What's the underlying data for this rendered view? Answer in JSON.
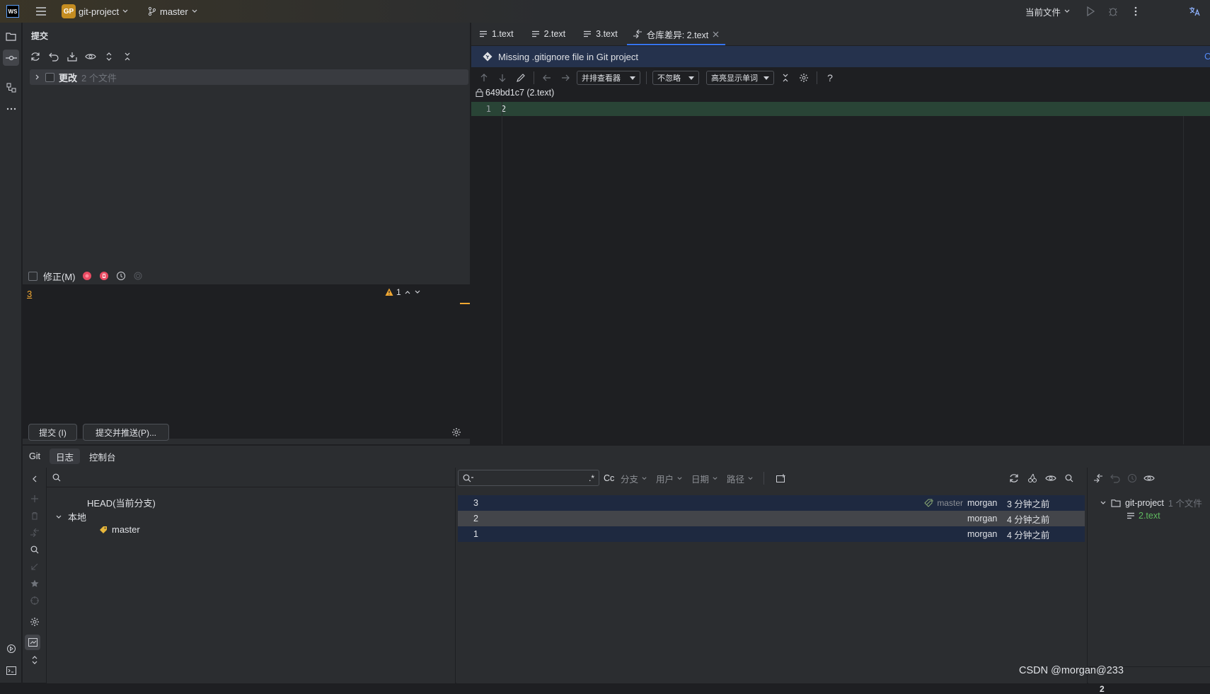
{
  "titlebar": {
    "app_logo": "WS",
    "project_badge": "GP",
    "project": "git-project",
    "branch": "master",
    "run_config": "当前文件"
  },
  "commit_panel": {
    "title": "提交",
    "changes_label": "更改",
    "changes_count": "2 个文件",
    "amend_label": "修正(M)",
    "message": "3",
    "warning_count": "1",
    "commit_button": "提交 (I)",
    "commit_push_button": "提交并推送(P)..."
  },
  "editor": {
    "tabs": [
      {
        "label": "1.text"
      },
      {
        "label": "2.text"
      },
      {
        "label": "3.text"
      },
      {
        "label": "仓库差异: 2.text"
      }
    ],
    "banner": "Missing .gitignore file in Git project",
    "banner_link": "C",
    "diff_viewer": "并排查看器",
    "ignore_mode": "不忽略",
    "highlight_mode": "高亮显示单词",
    "revision": "649bd1c7 (2.text)",
    "line_number": "1",
    "line_text": "2"
  },
  "git_panel": {
    "tabs": [
      "Git",
      "日志",
      "控制台"
    ],
    "tree": {
      "head": "HEAD(当前分支)",
      "local": "本地",
      "branch": "master"
    },
    "filters": {
      "regex": ".*",
      "case": "Cc",
      "branch": "分支",
      "user": "用户",
      "date": "日期",
      "path": "路径"
    },
    "commits": [
      {
        "message": "3",
        "tag": "master",
        "author": "morgan",
        "time": "3 分钟之前"
      },
      {
        "message": "2",
        "tag": "",
        "author": "morgan",
        "time": "4 分钟之前"
      },
      {
        "message": "1",
        "tag": "",
        "author": "morgan",
        "time": "4 分钟之前"
      }
    ],
    "files": {
      "root": "git-project",
      "count": "1 个文件",
      "file": "2.text"
    },
    "bottom_number": "2",
    "watermark": "CSDN @morgan@233"
  },
  "colors": {
    "accent": "#3574f0",
    "added_line": "#294436",
    "file_added": "#5fb85f",
    "badge": "#c58d21",
    "warning": "#f0a732",
    "graph": "#8aa873"
  }
}
